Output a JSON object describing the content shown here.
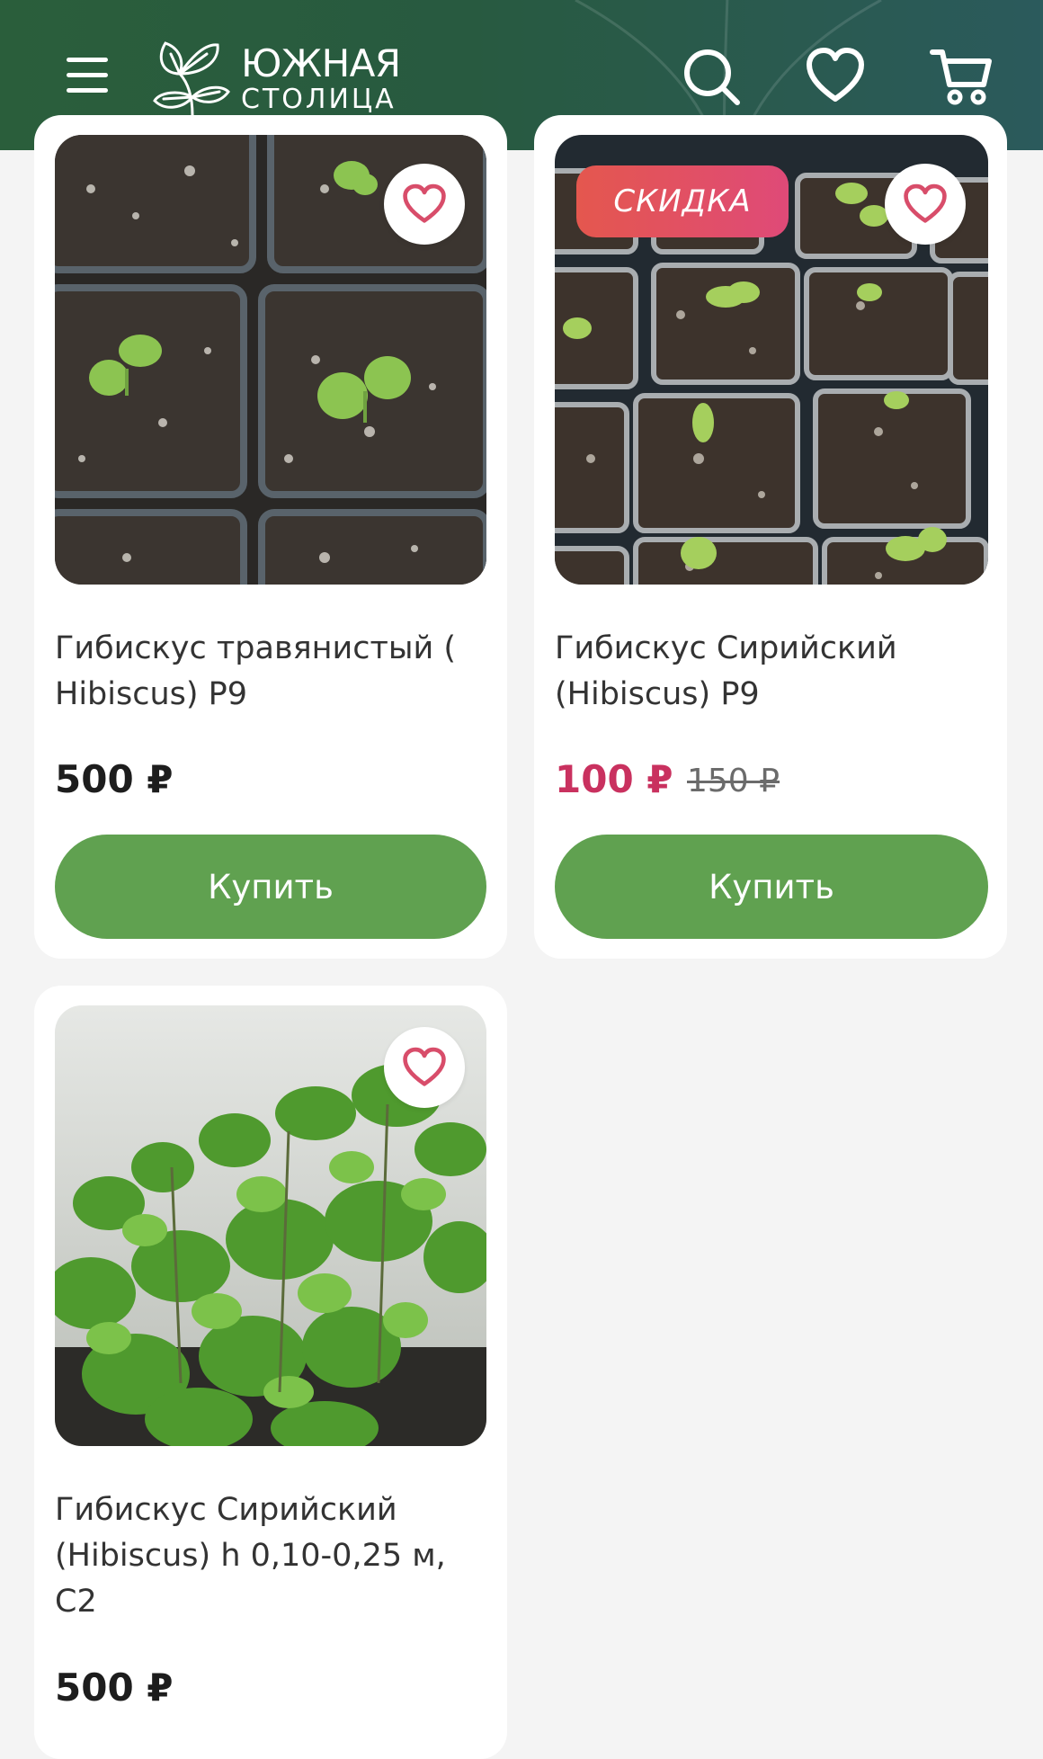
{
  "header": {
    "logo_line1": "ЮЖНАЯ",
    "logo_line2": "СТОЛИЦА",
    "icons": [
      "menu-icon",
      "search-icon",
      "heart-icon",
      "cart-icon"
    ]
  },
  "colors": {
    "header_green": "#2a5e3b",
    "buy_button": "#60a150",
    "sale_price": "#c9315f",
    "badge_start": "#e4574e",
    "badge_end": "#df4a78",
    "heart": "#d84d6a"
  },
  "products": [
    {
      "title": "Гибискус травянистый ( Hibiscus) P9",
      "price": "500 ₽",
      "old_price": "",
      "badge": "",
      "buy_label": "Купить"
    },
    {
      "title": "Гибискус Сирийский (Hibiscus) P9",
      "price": "100 ₽",
      "old_price": "150 ₽",
      "badge": "СКИДКА",
      "buy_label": "Купить"
    },
    {
      "title": "Гибискус Сирийский (Hibiscus) h 0,10-0,25 м, С2",
      "price": "500 ₽",
      "old_price": "",
      "badge": "",
      "buy_label": ""
    }
  ]
}
